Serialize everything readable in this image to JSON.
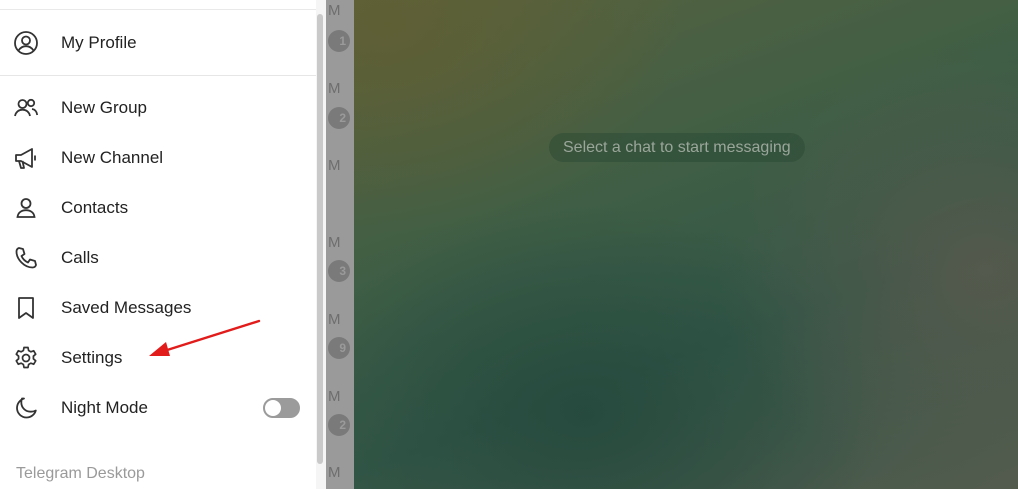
{
  "menu": {
    "profile": {
      "label": "My Profile",
      "icon": "profile-icon"
    },
    "items": [
      {
        "key": "new-group",
        "label": "New Group",
        "icon": "group-icon"
      },
      {
        "key": "new-channel",
        "label": "New Channel",
        "icon": "megaphone-icon"
      },
      {
        "key": "contacts",
        "label": "Contacts",
        "icon": "person-icon"
      },
      {
        "key": "calls",
        "label": "Calls",
        "icon": "phone-icon"
      },
      {
        "key": "saved-messages",
        "label": "Saved Messages",
        "icon": "bookmark-icon"
      },
      {
        "key": "settings",
        "label": "Settings",
        "icon": "gear-icon"
      },
      {
        "key": "night-mode",
        "label": "Night Mode",
        "icon": "moon-icon",
        "toggle": false
      }
    ],
    "footer": "Telegram Desktop"
  },
  "chat_list_strip": {
    "items": [
      {
        "time": "M",
        "badge": "1"
      },
      {
        "time": "M",
        "badge": "2"
      },
      {
        "time": "M",
        "badge": ""
      },
      {
        "time": "M",
        "badge": "3"
      },
      {
        "time": "M",
        "badge": "9"
      },
      {
        "time": "M",
        "badge": "2"
      },
      {
        "time": "M",
        "badge": ""
      }
    ]
  },
  "chat_pane": {
    "empty_hint": "Select a chat to start messaging"
  },
  "colors": {
    "annotation_arrow": "#e21b1b",
    "menu_text": "#222222",
    "footer_text": "#9a9a9a"
  }
}
